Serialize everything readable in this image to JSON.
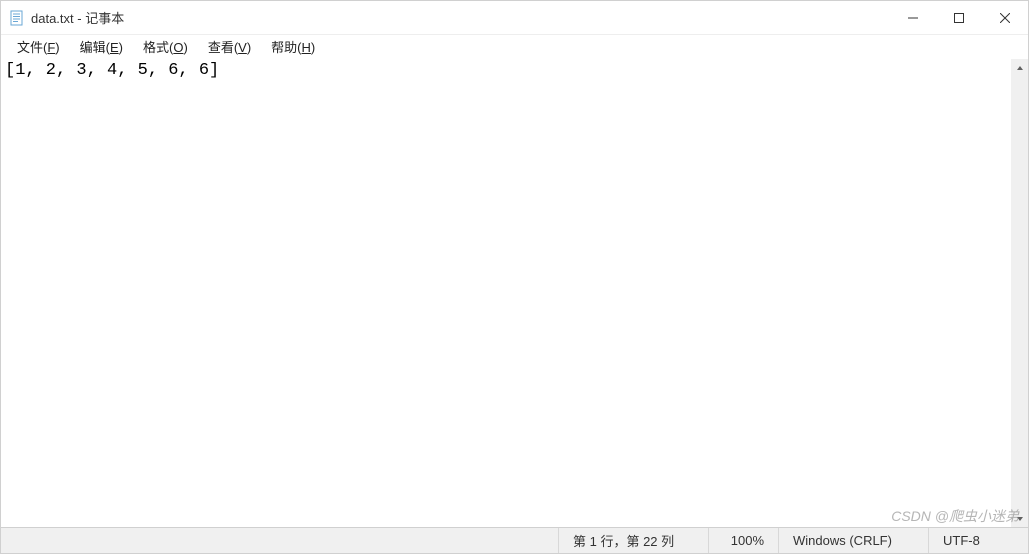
{
  "window": {
    "title": "data.txt - 记事本"
  },
  "menu": {
    "file": "文件(F)",
    "edit": "编辑(E)",
    "format": "格式(O)",
    "view": "查看(V)",
    "help": "帮助(H)"
  },
  "content": {
    "text": "[1, 2, 3, 4, 5, 6, 6]"
  },
  "status": {
    "position": "第 1 行，第 22 列",
    "zoom": "100%",
    "line_ending": "Windows (CRLF)",
    "encoding": "UTF-8"
  },
  "watermark": "CSDN @爬虫小迷弟"
}
